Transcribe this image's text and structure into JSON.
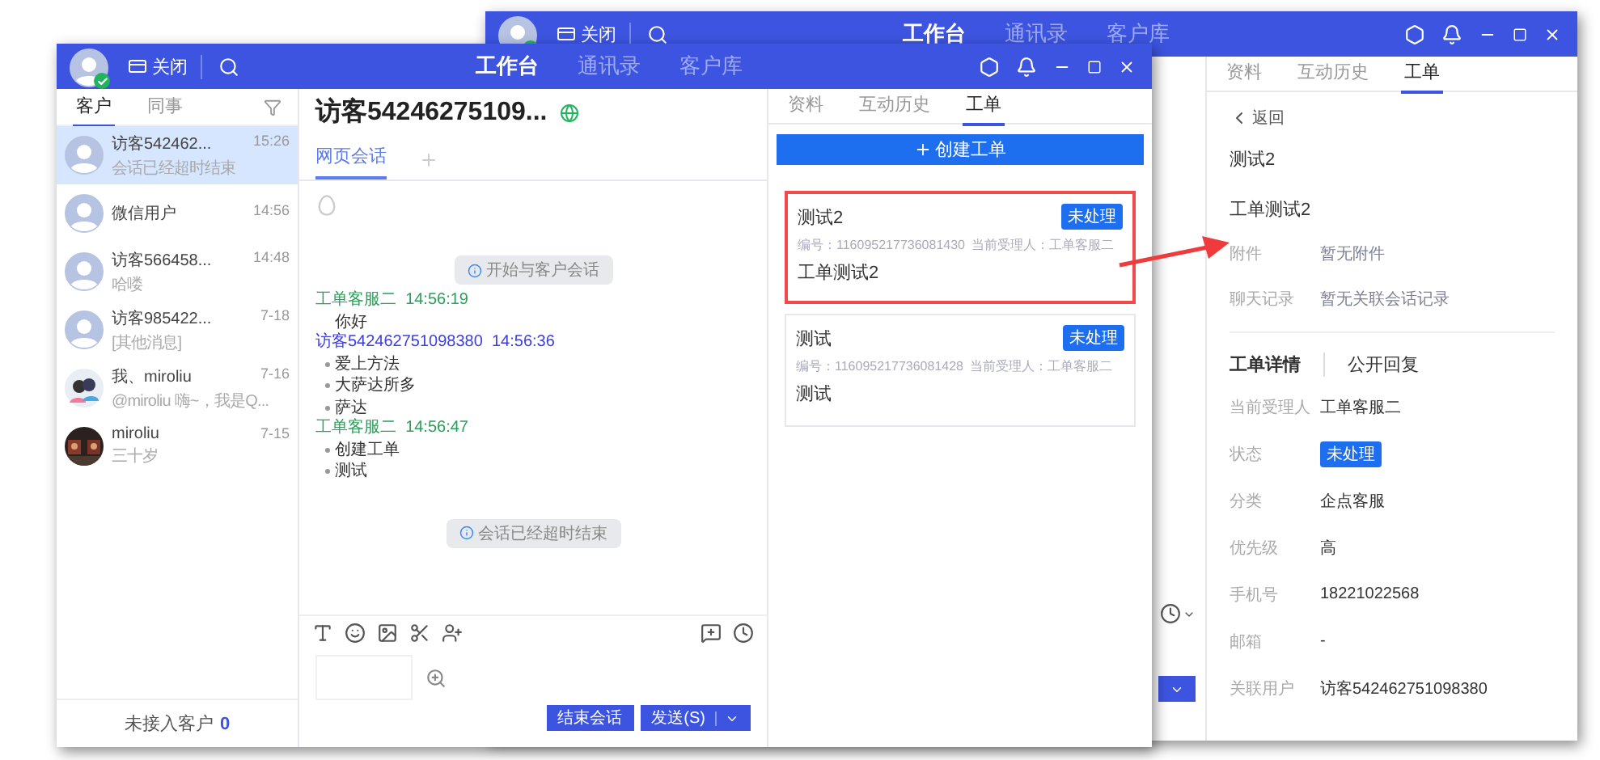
{
  "back_window": {
    "title_bar": {
      "close_label": "关闭",
      "nav": [
        {
          "label": "工作台",
          "selected": true
        },
        {
          "label": "通讯录",
          "selected": false
        },
        {
          "label": "客户库",
          "selected": false
        }
      ]
    },
    "panel_tabs": [
      {
        "label": "资料",
        "selected": false
      },
      {
        "label": "互动历史",
        "selected": false
      },
      {
        "label": "工单",
        "selected": true
      }
    ],
    "ticket": {
      "back_link": "返回",
      "title": "测试2",
      "description": "工单测试2",
      "info": [
        {
          "label": "附件",
          "value": "暂无附件"
        },
        {
          "label": "聊天记录",
          "value": "暂无关联会话记录"
        }
      ],
      "section_tabs": [
        {
          "label": "工单详情",
          "selected": true
        },
        {
          "label": "公开回复",
          "selected": false
        }
      ],
      "details": [
        {
          "label": "当前受理人",
          "value": "工单客服二",
          "kind": "text"
        },
        {
          "label": "状态",
          "value": "未处理",
          "kind": "badge"
        },
        {
          "label": "分类",
          "value": "企点客服",
          "kind": "text"
        },
        {
          "label": "优先级",
          "value": "高",
          "kind": "text"
        },
        {
          "label": "手机号",
          "value": "18221022568",
          "kind": "text"
        },
        {
          "label": "邮箱",
          "value": "-",
          "kind": "text"
        },
        {
          "label": "关联用户",
          "value": "访客542462751098380",
          "kind": "text"
        }
      ]
    }
  },
  "front_window": {
    "title_bar": {
      "close_label": "关闭",
      "nav": [
        {
          "label": "工作台",
          "selected": true
        },
        {
          "label": "通讯录",
          "selected": false
        },
        {
          "label": "客户库",
          "selected": false
        }
      ]
    },
    "sidebar": {
      "tabs": [
        {
          "label": "客户",
          "selected": true
        },
        {
          "label": "同事",
          "selected": false
        }
      ],
      "contacts": [
        {
          "name": "访客542462...",
          "time": "15:26",
          "preview": "会话已经超时结束",
          "kind": "placeholder",
          "selected": true
        },
        {
          "name": "微信用户",
          "time": "14:56",
          "kind": "placeholder",
          "selected": false
        },
        {
          "name": "访客566458...",
          "time": "14:48",
          "preview": "哈喽",
          "kind": "placeholder",
          "selected": false
        },
        {
          "name": "访客985422...",
          "time": "7-18",
          "preview": "[其他消息]",
          "kind": "placeholder",
          "selected": false
        },
        {
          "name": "我、miroliu",
          "time": "7-16",
          "preview": "@miroliu 嗨~，我是Q...",
          "kind": "cartoon",
          "selected": false
        },
        {
          "name": "miroliu",
          "time": "7-15",
          "preview": "三十岁",
          "selected": false
        }
      ],
      "footer": {
        "label": "未接入客户",
        "count": "0"
      }
    },
    "chat": {
      "title": "访客54246275109...",
      "tabs": [
        {
          "label": "网页会话",
          "selected": true
        }
      ],
      "messages": [
        {
          "kind": "system",
          "text": "开始与客户会话"
        },
        {
          "kind": "sender",
          "name": "工单客服二",
          "time": "14:56:19",
          "color": "#2e9e5b"
        },
        {
          "kind": "text",
          "text": "你好"
        },
        {
          "kind": "sender",
          "name": "访客542462751098380",
          "time": "14:56:36",
          "color": "#3b3fe0"
        },
        {
          "kind": "bullet",
          "text": "爱上方法"
        },
        {
          "kind": "bullet",
          "text": "大萨达所多"
        },
        {
          "kind": "bullet",
          "text": "萨达"
        },
        {
          "kind": "sender",
          "name": "工单客服二",
          "time": "14:56:47",
          "color": "#2e9e5b"
        },
        {
          "kind": "bullet",
          "text": "创建工单"
        },
        {
          "kind": "bullet",
          "text": "测试"
        },
        {
          "kind": "gap"
        },
        {
          "kind": "system",
          "text": "会话已经超时结束"
        }
      ],
      "end_button": "结束会话",
      "send_button": "发送(S)"
    },
    "tickets": {
      "tabs": [
        {
          "label": "资料",
          "selected": false
        },
        {
          "label": "互动历史",
          "selected": false
        },
        {
          "label": "工单",
          "selected": true
        }
      ],
      "create_button": "创建工单",
      "cards": [
        {
          "title": "测试2",
          "status": "未处理",
          "number": "编号：116095217736081430",
          "assignee": "当前受理人：工单客服二",
          "description": "工单测试2",
          "highlighted": true
        },
        {
          "title": "测试",
          "status": "未处理",
          "number": "编号：116095217736081428",
          "assignee": "当前受理人：工单客服二",
          "description": "测试",
          "highlighted": false
        }
      ]
    }
  }
}
